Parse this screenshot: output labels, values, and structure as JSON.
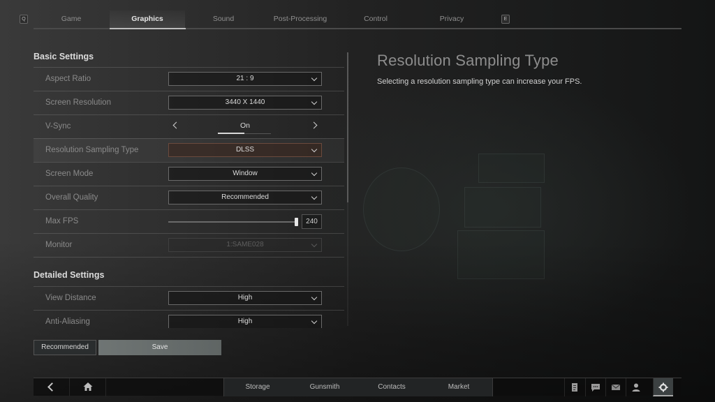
{
  "top_tabs": {
    "left_key": "Q",
    "right_key": "E",
    "tabs": [
      {
        "label": "Game",
        "active": false
      },
      {
        "label": "Graphics",
        "active": true
      },
      {
        "label": "Sound",
        "active": false
      },
      {
        "label": "Post-Processing",
        "active": false
      },
      {
        "label": "Control",
        "active": false
      },
      {
        "label": "Privacy",
        "active": false
      }
    ]
  },
  "settings": {
    "basic_title": "Basic Settings",
    "detailed_title": "Detailed Settings",
    "basic": [
      {
        "label": "Aspect Ratio",
        "type": "dropdown",
        "value": "21 : 9"
      },
      {
        "label": "Screen Resolution",
        "type": "dropdown",
        "value": "3440 X 1440"
      },
      {
        "label": "V-Sync",
        "type": "stepper",
        "value": "On",
        "step_index": 1,
        "step_count": 2
      },
      {
        "label": "Resolution Sampling Type",
        "type": "dropdown",
        "value": "DLSS",
        "selected": true
      },
      {
        "label": "Screen Mode",
        "type": "dropdown",
        "value": "Window"
      },
      {
        "label": "Overall Quality",
        "type": "dropdown",
        "value": "Recommended"
      },
      {
        "label": "Max FPS",
        "type": "slider",
        "value": "240",
        "fraction": 1.0
      },
      {
        "label": "Monitor",
        "type": "dropdown",
        "value": "1:SAME028",
        "disabled": true
      }
    ],
    "detailed": [
      {
        "label": "View Distance",
        "type": "dropdown",
        "value": "High"
      },
      {
        "label": "Anti-Aliasing",
        "type": "dropdown",
        "value": "High"
      }
    ],
    "scroll_fraction": 0.0
  },
  "actions": {
    "recommended_label": "Recommended",
    "save_label": "Save"
  },
  "description": {
    "title": "Resolution Sampling Type",
    "text": "Selecting a resolution sampling type can increase your FPS."
  },
  "bottom_nav": {
    "back_icon": "chevron-left-icon",
    "home_icon": "home-icon",
    "links": [
      "Storage",
      "Gunsmith",
      "Contacts",
      "Market"
    ],
    "right_icons": [
      {
        "name": "notes-icon",
        "active": false
      },
      {
        "name": "chat-icon",
        "active": false
      },
      {
        "name": "mail-icon",
        "active": false
      },
      {
        "name": "profile-icon",
        "active": false
      },
      {
        "name": "settings-gear-icon",
        "active": true
      }
    ]
  }
}
